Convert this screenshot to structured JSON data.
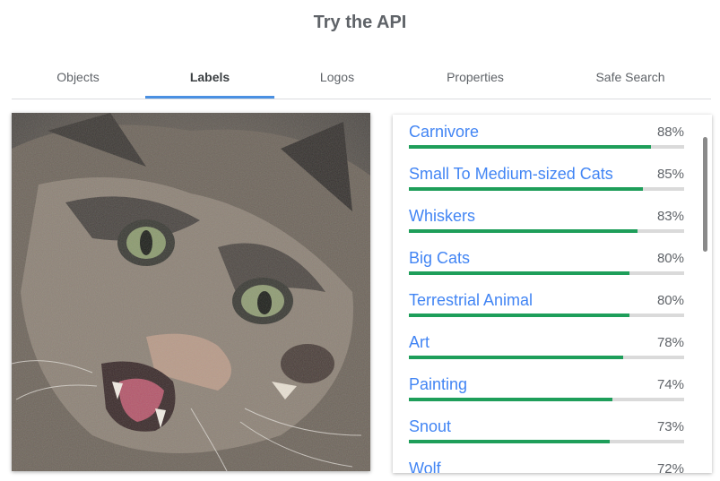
{
  "header": {
    "title": "Try the API"
  },
  "tabs": [
    {
      "label": "Objects",
      "active": false
    },
    {
      "label": "Labels",
      "active": true
    },
    {
      "label": "Logos",
      "active": false
    },
    {
      "label": "Properties",
      "active": false
    },
    {
      "label": "Safe Search",
      "active": false
    }
  ],
  "labels": [
    {
      "name": "Carnivore",
      "percent": "88%",
      "score": 88
    },
    {
      "name": "Small To Medium-sized Cats",
      "percent": "85%",
      "score": 85
    },
    {
      "name": "Whiskers",
      "percent": "83%",
      "score": 83
    },
    {
      "name": "Big Cats",
      "percent": "80%",
      "score": 80
    },
    {
      "name": "Terrestrial Animal",
      "percent": "80%",
      "score": 80
    },
    {
      "name": "Art",
      "percent": "78%",
      "score": 78
    },
    {
      "name": "Painting",
      "percent": "74%",
      "score": 74
    },
    {
      "name": "Snout",
      "percent": "73%",
      "score": 73
    },
    {
      "name": "Wolf",
      "percent": "72%",
      "score": 72
    }
  ],
  "colors": {
    "accent": "#4a90e2",
    "bar": "#1e9e5a",
    "link": "#4285f4"
  }
}
